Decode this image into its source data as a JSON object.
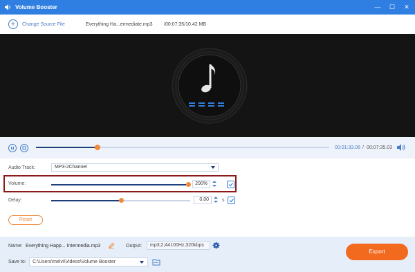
{
  "window": {
    "title": "Volume Booster",
    "controls": {
      "minimize": "—",
      "maximize": "☐",
      "close": "✕"
    }
  },
  "source": {
    "change_label": "Change Source File",
    "file_name": "Everything Ha...ermediate.mp3",
    "time_size": "/00:07:35/10.42 MB"
  },
  "player": {
    "current_time": "00:01:33.06",
    "separator": "/",
    "total_time": "00:07:35.03",
    "progress": 0.21
  },
  "settings": {
    "audio_track_label": "Audio Track:",
    "audio_track_value": "MP3-2Channel",
    "volume_label": "Volume:",
    "volume_value": "200%",
    "volume_level": 1.0,
    "delay_label": "Delay:",
    "delay_value": "0.00",
    "delay_unit": "s",
    "delay_level": 0.5,
    "reset_label": "Reset"
  },
  "bottom": {
    "name_label": "Name:",
    "name_value": "Everything Happ... Intermedia.mp3",
    "output_label": "Output:",
    "output_value": "mp3;2;44100Hz;320kbps",
    "save_to_label": "Save to:",
    "save_to_value": "C:\\Users\\melvi\\Videos\\Volume Booster",
    "export_label": "Export"
  },
  "colors": {
    "titlebar": "#2f7fe2",
    "accent_orange": "#f0893a",
    "export_orange": "#f26a1e",
    "slider_fill": "#1f3f7a",
    "highlight_frame": "#8b1a1a"
  }
}
